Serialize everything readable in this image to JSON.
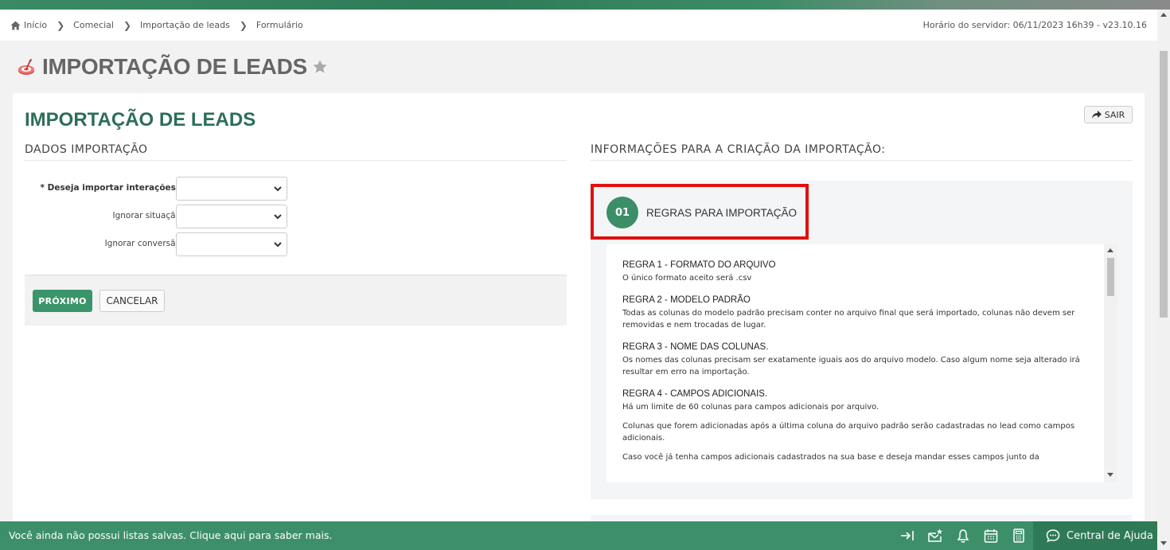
{
  "breadcrumb": {
    "items": [
      "Início",
      "Comecial",
      "Importação de leads",
      "Formulário"
    ]
  },
  "server_time": "Horário do servidor: 06/11/2023 16h39 - v23.10.16",
  "page": {
    "title": "IMPORTAÇÃO DE LEADS",
    "favorite_icon": "star-icon",
    "module_icon": "target-icon"
  },
  "card": {
    "title": "IMPORTAÇÃO DE LEADS",
    "exit_label": "SAIR"
  },
  "form": {
    "section_title": "DADOS IMPORTAÇÃO",
    "fields": [
      {
        "label": "* Deseja importar interações?",
        "value": ""
      },
      {
        "label": "Ignorar situação",
        "value": ""
      },
      {
        "label": "Ignorar conversão",
        "value": ""
      }
    ],
    "next_label": "PRÓXIMO",
    "cancel_label": "CANCELAR"
  },
  "info": {
    "section_title": "INFORMAÇÕES PARA A CRIAÇÃO DA IMPORTAÇÃO:",
    "step_number": "01",
    "step_title": "REGRAS PARA IMPORTAÇÃO",
    "rules": [
      {
        "title": "REGRA 1 - FORMATO DO ARQUIVO",
        "texts": [
          "O único formato aceito será .csv"
        ]
      },
      {
        "title": "REGRA 2 - MODELO PADRÃO",
        "texts": [
          "Todas as colunas do modelo padrão precisam conter no arquivo final que será importado, colunas não devem ser removidas e nem trocadas de lugar."
        ]
      },
      {
        "title": "REGRA 3 - NOME DAS COLUNAS.",
        "texts": [
          "Os nomes das colunas precisam ser exatamente iguais aos do arquivo modelo. Caso algum nome seja alterado irá resultar em erro na importação."
        ]
      },
      {
        "title": "REGRA 4 - CAMPOS ADICIONAIS.",
        "texts": [
          "Há um limite de 60 colunas para campos adicionais por arquivo.",
          "Colunas que forem adicionadas após a última coluna do arquivo padrão serão cadastradas no lead como campos adicionais.",
          "Caso você já tenha campos adicionais cadastrados na sua base e deseja mandar esses campos junto da"
        ]
      }
    ]
  },
  "footer": {
    "message": "Você ainda não possui listas salvas. Clique aqui para saber mais.",
    "icons": [
      "sign-in-icon",
      "mail-star-icon",
      "bell-icon",
      "calendar-icon",
      "calculator-icon"
    ],
    "help_label": "Central de Ajuda"
  },
  "colors": {
    "brand_green": "#3d8f69",
    "title_green": "#2d6e57",
    "highlight_red": "#e20f0f"
  }
}
